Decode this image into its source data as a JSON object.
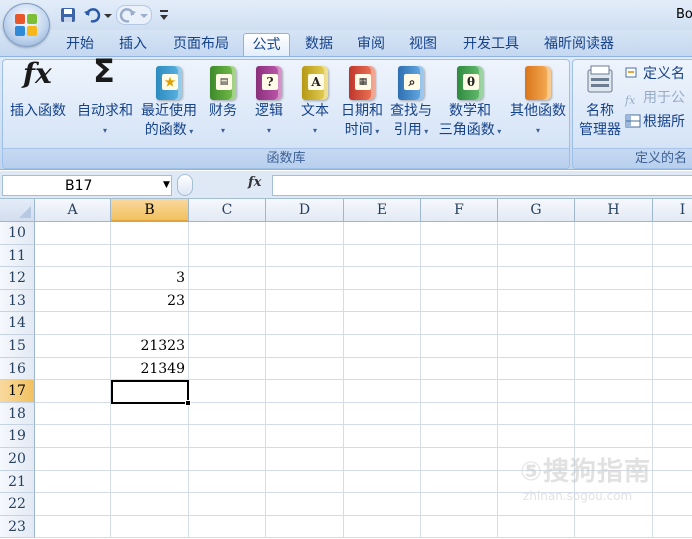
{
  "window": {
    "title": "Bo"
  },
  "tabs": [
    {
      "label": "开始"
    },
    {
      "label": "插入"
    },
    {
      "label": "页面布局"
    },
    {
      "label": "公式",
      "active": true
    },
    {
      "label": "数据"
    },
    {
      "label": "审阅"
    },
    {
      "label": "视图"
    },
    {
      "label": "开发工具"
    },
    {
      "label": "福昕阅读器"
    }
  ],
  "ribbon": {
    "function_library": {
      "label": "函数库",
      "insert_function": "插入函数",
      "autosum": "自动求和",
      "recent_line1": "最近使用",
      "recent_line2": "的函数",
      "financial": "财务",
      "logical": "逻辑",
      "text": "文本",
      "datetime_line1": "日期和",
      "datetime_line2": "时间",
      "lookup_line1": "查找与",
      "lookup_line2": "引用",
      "math_line1": "数学和",
      "math_line2": "三角函数",
      "more": "其他函数"
    },
    "defined_names": {
      "label": "定义的名",
      "name_manager_line1": "名称",
      "name_manager_line2": "管理器",
      "define_name": "定义名",
      "use_in_formula": "用于公",
      "create_from_selection": "根据所"
    }
  },
  "formula_bar": {
    "name_box": "B17",
    "fx": "fx",
    "formula": ""
  },
  "grid": {
    "columns": [
      "A",
      "B",
      "C",
      "D",
      "E",
      "F",
      "G",
      "H",
      "I"
    ],
    "selected_column": "B",
    "selected_row": "17",
    "rows": [
      {
        "num": "10",
        "b": ""
      },
      {
        "num": "11",
        "b": ""
      },
      {
        "num": "12",
        "b": "3"
      },
      {
        "num": "13",
        "b": "23"
      },
      {
        "num": "14",
        "b": ""
      },
      {
        "num": "15",
        "b": "21323"
      },
      {
        "num": "16",
        "b": "21349"
      },
      {
        "num": "17",
        "b": ""
      },
      {
        "num": "18",
        "b": ""
      },
      {
        "num": "19",
        "b": ""
      },
      {
        "num": "20",
        "b": ""
      },
      {
        "num": "21",
        "b": ""
      },
      {
        "num": "22",
        "b": ""
      },
      {
        "num": "23",
        "b": ""
      }
    ]
  },
  "watermark": {
    "text": "⑤搜狗指南",
    "url": "zhinan.sogou.com"
  }
}
